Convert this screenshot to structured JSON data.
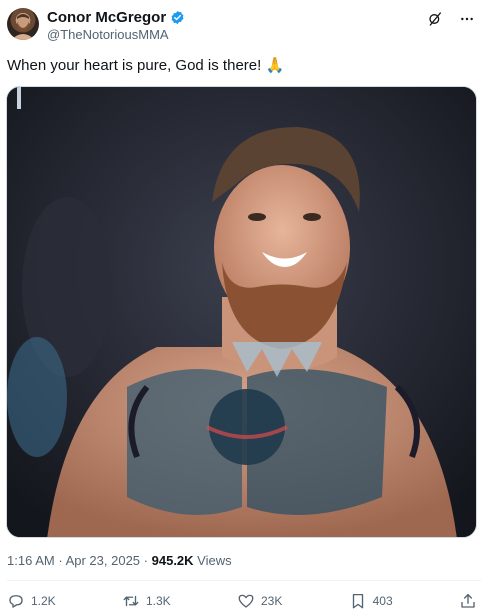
{
  "author": {
    "name": "Conor McGregor",
    "handle": "@TheNotoriousMMA",
    "verified_color": "#1d9bf0"
  },
  "tweet": {
    "text": "When your heart is pure, God is there! 🙏",
    "time": "1:16 AM",
    "separator": "·",
    "date": "Apr 23, 2025",
    "views_count": "945.2K",
    "views_label": "Views"
  },
  "top_actions": {
    "grok_icon": "grok-icon",
    "more_icon": "more-options-icon"
  },
  "actions": {
    "replies": "1.2K",
    "reposts": "1.3K",
    "likes": "23K",
    "bookmarks": "403"
  },
  "colors": {
    "text_primary": "#0f1419",
    "text_secondary": "#536471",
    "accent": "#1d9bf0"
  }
}
